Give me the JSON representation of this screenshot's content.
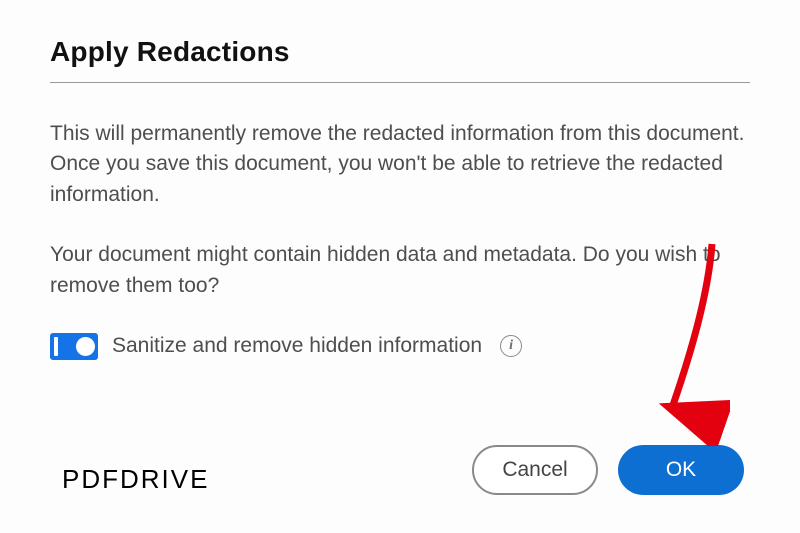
{
  "dialog": {
    "title": "Apply Redactions",
    "paragraph1": "This will permanently remove the redacted information from this document. Once you save this document, you won't be able to retrieve the redacted information.",
    "paragraph2": "Your document might contain hidden data and metadata. Do you wish to remove them too?",
    "toggle_label": "Sanitize and remove hidden information",
    "buttons": {
      "cancel": "Cancel",
      "ok": "OK"
    }
  },
  "watermark": "PDFDRIVE"
}
